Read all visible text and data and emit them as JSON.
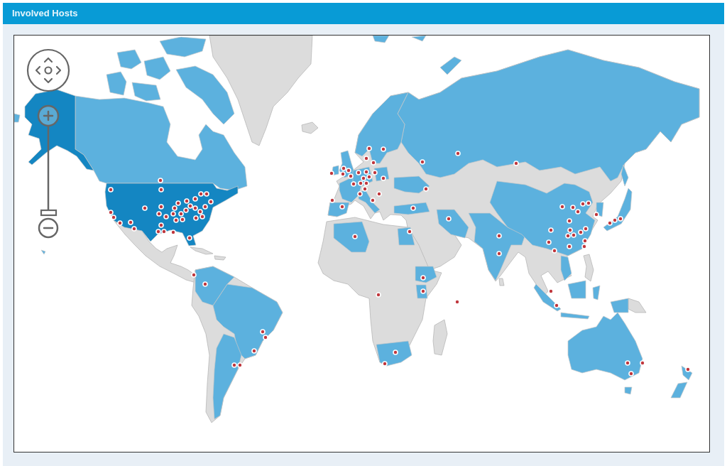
{
  "panel": {
    "title": "Involved Hosts"
  },
  "map": {
    "zoom_slider": {
      "level": 0
    }
  }
}
